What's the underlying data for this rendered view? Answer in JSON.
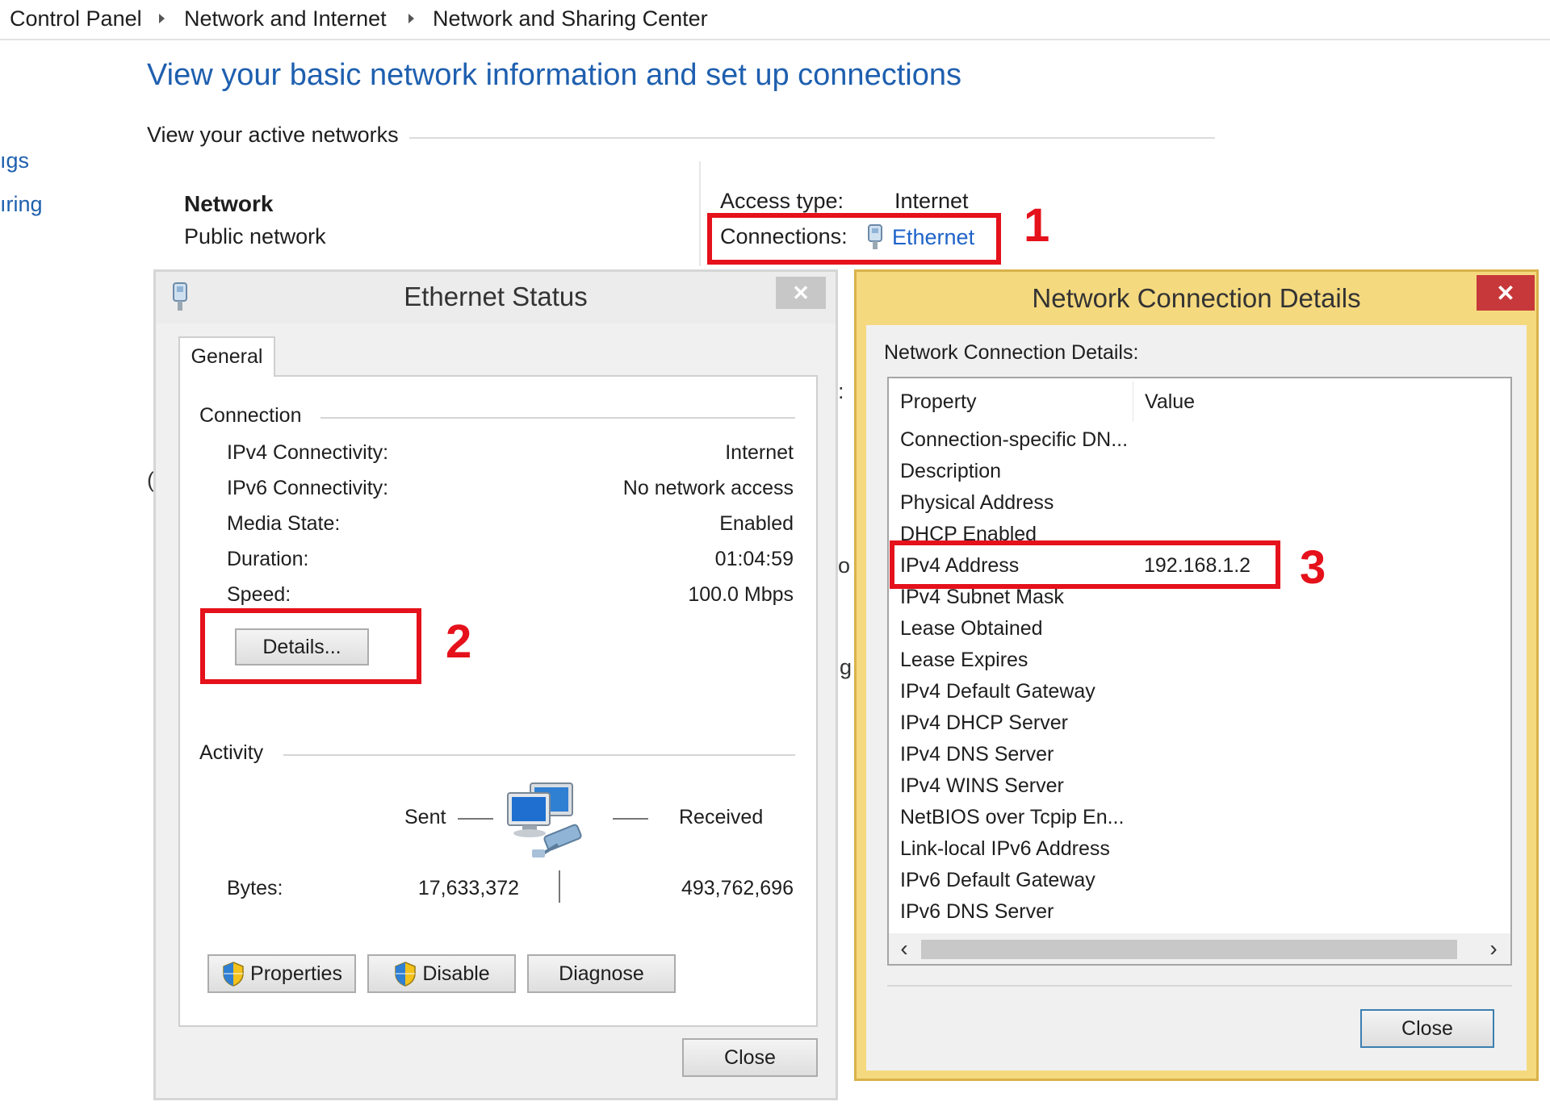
{
  "breadcrumb": {
    "items": [
      "Control Panel",
      "Network and Internet",
      "Network and Sharing Center"
    ]
  },
  "page": {
    "title": "View your basic network information and set up connections",
    "active_networks_label": "View your active networks",
    "sidebar_fragments": [
      "ıgs",
      "ıring"
    ],
    "occluded_fragments": [
      "(",
      ":",
      "o",
      "g"
    ]
  },
  "network": {
    "name": "Network",
    "type": "Public network",
    "access_type_label": "Access type:",
    "access_type_value": "Internet",
    "connections_label": "Connections:",
    "connections_value": "Ethernet"
  },
  "callouts": [
    "1",
    "2",
    "3"
  ],
  "ethernet_status": {
    "title": "Ethernet Status",
    "close_x": "✕",
    "tab": "General",
    "connection_group": "Connection",
    "rows": [
      {
        "label": "IPv4 Connectivity:",
        "value": "Internet"
      },
      {
        "label": "IPv6 Connectivity:",
        "value": "No network access"
      },
      {
        "label": "Media State:",
        "value": "Enabled"
      },
      {
        "label": "Duration:",
        "value": "01:04:59"
      },
      {
        "label": "Speed:",
        "value": "100.0 Mbps"
      }
    ],
    "details_button": "Details...",
    "activity_group": "Activity",
    "sent_label": "Sent",
    "received_label": "Received",
    "bytes_label": "Bytes:",
    "bytes_sent": "17,633,372",
    "bytes_received": "493,762,696",
    "properties_button": "Properties",
    "disable_button": "Disable",
    "diagnose_button": "Diagnose",
    "close_button": "Close"
  },
  "connection_details": {
    "title": "Network Connection Details",
    "close_x": "✕",
    "heading": "Network Connection Details:",
    "columns": [
      "Property",
      "Value"
    ],
    "rows": [
      {
        "property": "Connection-specific DN...",
        "value": ""
      },
      {
        "property": "Description",
        "value": ""
      },
      {
        "property": "Physical Address",
        "value": ""
      },
      {
        "property": "DHCP Enabled",
        "value": ""
      },
      {
        "property": "IPv4 Address",
        "value": "192.168.1.2"
      },
      {
        "property": "IPv4 Subnet Mask",
        "value": ""
      },
      {
        "property": "Lease Obtained",
        "value": ""
      },
      {
        "property": "Lease Expires",
        "value": ""
      },
      {
        "property": "IPv4 Default Gateway",
        "value": ""
      },
      {
        "property": "IPv4 DHCP Server",
        "value": ""
      },
      {
        "property": "IPv4 DNS Server",
        "value": ""
      },
      {
        "property": "IPv4 WINS Server",
        "value": ""
      },
      {
        "property": "NetBIOS over Tcpip En...",
        "value": ""
      },
      {
        "property": "Link-local IPv6 Address",
        "value": ""
      },
      {
        "property": "IPv6 Default Gateway",
        "value": ""
      },
      {
        "property": "IPv6 DNS Server",
        "value": ""
      }
    ],
    "scroll_left": "‹",
    "scroll_right": "›",
    "close_button": "Close"
  },
  "colors": {
    "link_blue": "#1e5faf",
    "highlight_red": "#e5111b",
    "dialog_gold": "#f5d97f",
    "close_red": "#c7383a"
  }
}
